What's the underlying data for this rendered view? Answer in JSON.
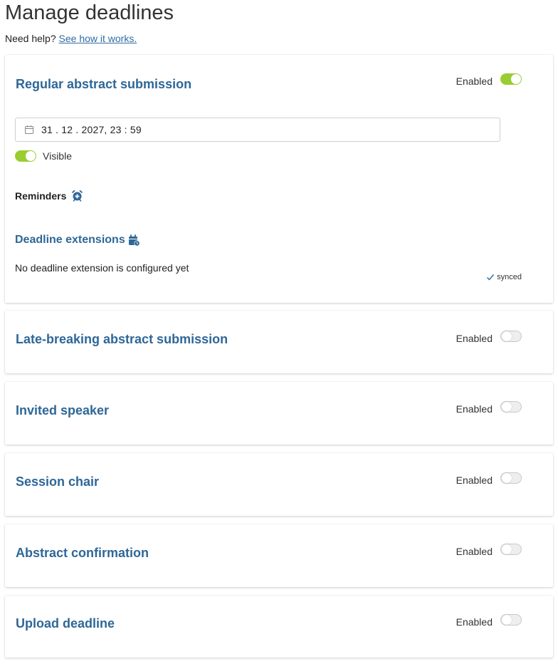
{
  "page": {
    "title": "Manage deadlines",
    "help_prefix": "Need help?",
    "help_link": "See how it works."
  },
  "colors": {
    "accent": "#2e6797",
    "toggle_on": "#9acd32",
    "toggle_off": "#eeeeee"
  },
  "deadlines": [
    {
      "title": "Regular abstract submission",
      "enabled_label": "Enabled",
      "enabled": true,
      "date_value": "31 . 12 . 2027, 23 : 59",
      "visible_label": "Visible",
      "visible": true,
      "reminders_label": "Reminders",
      "extensions_title": "Deadline extensions",
      "no_extension_text": "No deadline extension is configured yet",
      "sync_status": "synced"
    },
    {
      "title": "Late-breaking abstract submission",
      "enabled_label": "Enabled",
      "enabled": false
    },
    {
      "title": "Invited speaker",
      "enabled_label": "Enabled",
      "enabled": false
    },
    {
      "title": "Session chair",
      "enabled_label": "Enabled",
      "enabled": false
    },
    {
      "title": "Abstract confirmation",
      "enabled_label": "Enabled",
      "enabled": false
    },
    {
      "title": "Upload deadline",
      "enabled_label": "Enabled",
      "enabled": false
    }
  ],
  "icons": {
    "calendar": "calendar-icon",
    "alarm_add": "alarm-add-icon",
    "calendar_clock": "calendar-clock-icon",
    "check": "check-icon"
  }
}
